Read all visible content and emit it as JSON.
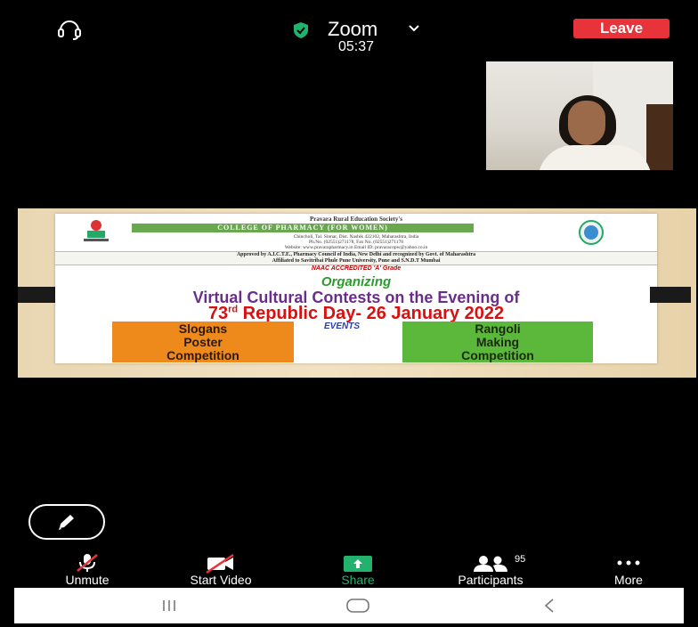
{
  "header": {
    "app_title": "Zoom",
    "timer": "05:37",
    "leave_label": "Leave"
  },
  "shared_content": {
    "society": "Pravara Rural Education Society's",
    "college": "COLLEGE OF PHARMACY (FOR WOMEN)",
    "address_line_1": "Chincholi, Tal. Sinnar, Dist. Nashik 422102, Maharashtra, India",
    "address_line_2": "Ph.No. (02551)271178, Fax No. (02551)271178",
    "address_line_3": "Website: www.pravarapharmacy.in          Email ID: pravaracopw@yahoo.co.in",
    "approved_line_1": "Approved by A.I.C.T.E., Pharmacy Council of India, New Delhi and recognized by Govt. of Maharashtra",
    "approved_line_2": "Affiliated to Savitribai Phule Pune University, Pune and S.N.D.T Mumbai",
    "naac": "NAAC ACCREDITED 'A' Grade",
    "organizing": "Organizing",
    "contests": "Virtual Cultural Contests on the Evening of",
    "republic_number": "73",
    "republic_suffix": "rd",
    "republic_rest": " Republic Day- 26 January 2022",
    "events_label": "EVENTS",
    "event_1": "Slogans\nPoster\nCompetition",
    "event_2": "Rangoli\nMaking\nCompetition"
  },
  "toolbar": {
    "unmute": "Unmute",
    "start_video": "Start Video",
    "share": "Share",
    "participants": "Participants",
    "participant_count": "95",
    "more": "More"
  },
  "colors": {
    "leave": "#e8333a",
    "share_green": "#23b26d",
    "shield_green": "#23b26d",
    "muted_red": "#e8333a"
  }
}
